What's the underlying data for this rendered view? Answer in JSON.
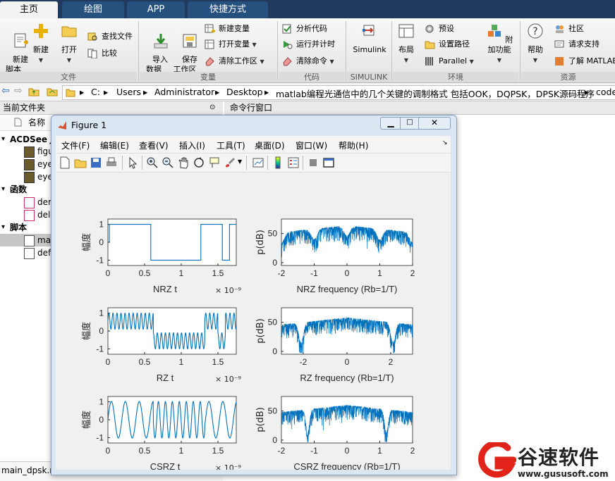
{
  "tabs": [
    "主页",
    "绘图",
    "APP",
    "快捷方式"
  ],
  "ribbon": {
    "file_group": {
      "label": "文件",
      "new_script": "新建\n脚本",
      "new": "新建",
      "open": "打开",
      "find_files": "查找文件",
      "compare": "比较"
    },
    "variable_group": {
      "label": "变量",
      "import": "导入\n数据",
      "save_workspace": "保存\n工作区",
      "new_variable": "新建变量",
      "open_variable": "打开变量",
      "clear_workspace": "清除工作区"
    },
    "code_group": {
      "label": "代码",
      "analyze": "分析代码",
      "run_time": "运行并计时",
      "clear_commands": "清除命令"
    },
    "simulink_group": {
      "label": "SIMULINK",
      "simulink": "Simulink"
    },
    "env_group": {
      "label": "环境",
      "layout": "布局",
      "preferences": "预设",
      "set_path": "设置路径",
      "parallel": "Parallel",
      "addons": "附加功能"
    },
    "resources_group": {
      "label": "资源",
      "help": "帮助",
      "community": "社区",
      "support": "请求支持",
      "learn": "了解 MATLAB"
    }
  },
  "address": [
    "C:",
    "Users",
    "Administrator",
    "Desktop",
    "matlab编程光通信中的几个关键的调制格式 包括OOK，DQPSK，DPSK源码程序",
    "code"
  ],
  "current_folder": {
    "title": "当前文件夹",
    "column_name": "名称",
    "sections": [
      {
        "label": "ACDSee J",
        "items": [
          "figu",
          "eye",
          "eye"
        ]
      },
      {
        "label": "函数",
        "items": [
          "der",
          "del"
        ]
      },
      {
        "label": "脚本",
        "items": [
          "ma",
          "def"
        ]
      }
    ],
    "status_file": "main_dpsk.r"
  },
  "command_window": {
    "title": "命令行窗口"
  },
  "figure": {
    "title": "Figure 1",
    "menus": [
      "文件(F)",
      "编辑(E)",
      "查看(V)",
      "插入(I)",
      "工具(T)",
      "桌面(D)",
      "窗口(W)",
      "帮助(H)"
    ]
  },
  "chart_data": [
    {
      "type": "line",
      "xlabel": "NRZ    t",
      "ylabel": "幅度",
      "x_exponent": "× 10⁻⁹",
      "xlim": [
        0,
        1.75
      ],
      "ylim": [
        -1.3,
        1.3
      ],
      "xticks": [
        0,
        0.5,
        1,
        1.5
      ],
      "yticks": [
        -1,
        0,
        1
      ],
      "signal": "nrz",
      "bits": [
        1,
        1,
        1,
        1,
        1,
        1,
        0,
        0,
        0,
        0,
        0,
        0,
        0,
        1,
        1,
        1,
        0,
        1
      ]
    },
    {
      "type": "line",
      "xlabel": "NRZ    frequency (Rb=1/T)",
      "ylabel": "p(dB)",
      "xlim": [
        -2,
        2
      ],
      "ylim": [
        -5,
        75
      ],
      "xticks": [
        -2,
        -1,
        0,
        1,
        2
      ],
      "yticks": [
        0,
        50
      ]
    },
    {
      "type": "line",
      "xlabel": "RZ    t",
      "ylabel": "幅度",
      "x_exponent": "× 10⁻⁹",
      "xlim": [
        0,
        1.75
      ],
      "ylim": [
        -1.3,
        1.3
      ],
      "xticks": [
        0,
        0.5,
        1,
        1.5
      ],
      "yticks": [
        -1,
        0,
        1
      ],
      "signal": "rz"
    },
    {
      "type": "line",
      "xlabel": "RZ    frequency (Rb=1/T)",
      "ylabel": "p(dB)",
      "xlim": [
        -3,
        3
      ],
      "ylim": [
        -5,
        75
      ],
      "xticks": [
        -2,
        0,
        2
      ],
      "yticks": [
        0,
        50
      ]
    },
    {
      "type": "line",
      "xlabel": "CSRZ    t",
      "ylabel": "幅度",
      "x_exponent": "× 10⁻⁹",
      "xlim": [
        0,
        1.75
      ],
      "ylim": [
        -1.3,
        1.3
      ],
      "xticks": [
        0,
        0.5,
        1,
        1.5
      ],
      "yticks": [
        -1,
        0,
        1
      ],
      "signal": "csrz"
    },
    {
      "type": "line",
      "xlabel": "CSRZ    frequency (Rb=1/T)",
      "ylabel": "p(dB)",
      "xlim": [
        -2,
        2
      ],
      "ylim": [
        -5,
        75
      ],
      "xticks": [
        -2,
        -1,
        0,
        1,
        2
      ],
      "yticks": [
        0,
        50
      ]
    }
  ],
  "watermark": {
    "brand": "谷速软件",
    "url": "www.gususoft.com",
    "color": "#e2231a"
  }
}
